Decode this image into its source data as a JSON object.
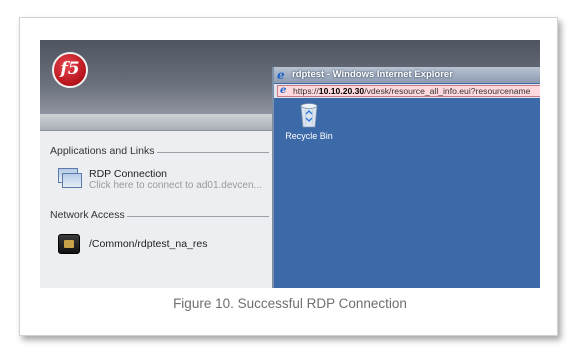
{
  "logo": {
    "text": "f5"
  },
  "left_panel": {
    "applications_heading": "Applications and Links",
    "applications": [
      {
        "title": "RDP Connection",
        "subtitle": "Click here to connect to ad01.devcen..."
      }
    ],
    "network_heading": "Network Access",
    "network_items": [
      {
        "label": "/Common/rdptest_na_res"
      }
    ]
  },
  "ie_window": {
    "title": "rdptest - Windows Internet Explorer",
    "address": {
      "prefix": "https://",
      "host": "10.10.20.30",
      "path": "/vdesk/resource_all_info.eui?resourcename"
    }
  },
  "desktop": {
    "icons": [
      {
        "label": "Recycle Bin",
        "icon": "recycle-bin-icon"
      }
    ]
  },
  "caption": "Figure 10. Successful RDP Connection",
  "colors": {
    "desktop": "#3c6aa8",
    "banner": "#5b616c",
    "logo_red": "#c8161f"
  }
}
